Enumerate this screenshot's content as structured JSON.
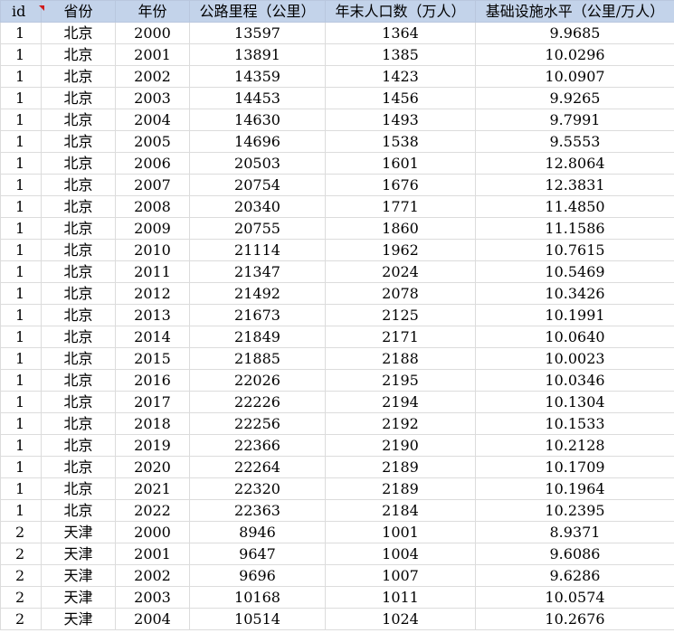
{
  "colors": {
    "header_bg": "#c3d3ea",
    "gridline": "#dcdcdc",
    "comment_marker": "#d01c1c"
  },
  "headers": [
    "id",
    "省份",
    "年份",
    "公路里程（公里）",
    "年末人口数（万人）",
    "基础设施水平（公里/万人）"
  ],
  "rows": [
    [
      "1",
      "北京",
      "2000",
      "13597",
      "1364",
      "9.9685"
    ],
    [
      "1",
      "北京",
      "2001",
      "13891",
      "1385",
      "10.0296"
    ],
    [
      "1",
      "北京",
      "2002",
      "14359",
      "1423",
      "10.0907"
    ],
    [
      "1",
      "北京",
      "2003",
      "14453",
      "1456",
      "9.9265"
    ],
    [
      "1",
      "北京",
      "2004",
      "14630",
      "1493",
      "9.7991"
    ],
    [
      "1",
      "北京",
      "2005",
      "14696",
      "1538",
      "9.5553"
    ],
    [
      "1",
      "北京",
      "2006",
      "20503",
      "1601",
      "12.8064"
    ],
    [
      "1",
      "北京",
      "2007",
      "20754",
      "1676",
      "12.3831"
    ],
    [
      "1",
      "北京",
      "2008",
      "20340",
      "1771",
      "11.4850"
    ],
    [
      "1",
      "北京",
      "2009",
      "20755",
      "1860",
      "11.1586"
    ],
    [
      "1",
      "北京",
      "2010",
      "21114",
      "1962",
      "10.7615"
    ],
    [
      "1",
      "北京",
      "2011",
      "21347",
      "2024",
      "10.5469"
    ],
    [
      "1",
      "北京",
      "2012",
      "21492",
      "2078",
      "10.3426"
    ],
    [
      "1",
      "北京",
      "2013",
      "21673",
      "2125",
      "10.1991"
    ],
    [
      "1",
      "北京",
      "2014",
      "21849",
      "2171",
      "10.0640"
    ],
    [
      "1",
      "北京",
      "2015",
      "21885",
      "2188",
      "10.0023"
    ],
    [
      "1",
      "北京",
      "2016",
      "22026",
      "2195",
      "10.0346"
    ],
    [
      "1",
      "北京",
      "2017",
      "22226",
      "2194",
      "10.1304"
    ],
    [
      "1",
      "北京",
      "2018",
      "22256",
      "2192",
      "10.1533"
    ],
    [
      "1",
      "北京",
      "2019",
      "22366",
      "2190",
      "10.2128"
    ],
    [
      "1",
      "北京",
      "2020",
      "22264",
      "2189",
      "10.1709"
    ],
    [
      "1",
      "北京",
      "2021",
      "22320",
      "2189",
      "10.1964"
    ],
    [
      "1",
      "北京",
      "2022",
      "22363",
      "2184",
      "10.2395"
    ],
    [
      "2",
      "天津",
      "2000",
      "8946",
      "1001",
      "8.9371"
    ],
    [
      "2",
      "天津",
      "2001",
      "9647",
      "1004",
      "9.6086"
    ],
    [
      "2",
      "天津",
      "2002",
      "9696",
      "1007",
      "9.6286"
    ],
    [
      "2",
      "天津",
      "2003",
      "10168",
      "1011",
      "10.0574"
    ],
    [
      "2",
      "天津",
      "2004",
      "10514",
      "1024",
      "10.2676"
    ]
  ]
}
